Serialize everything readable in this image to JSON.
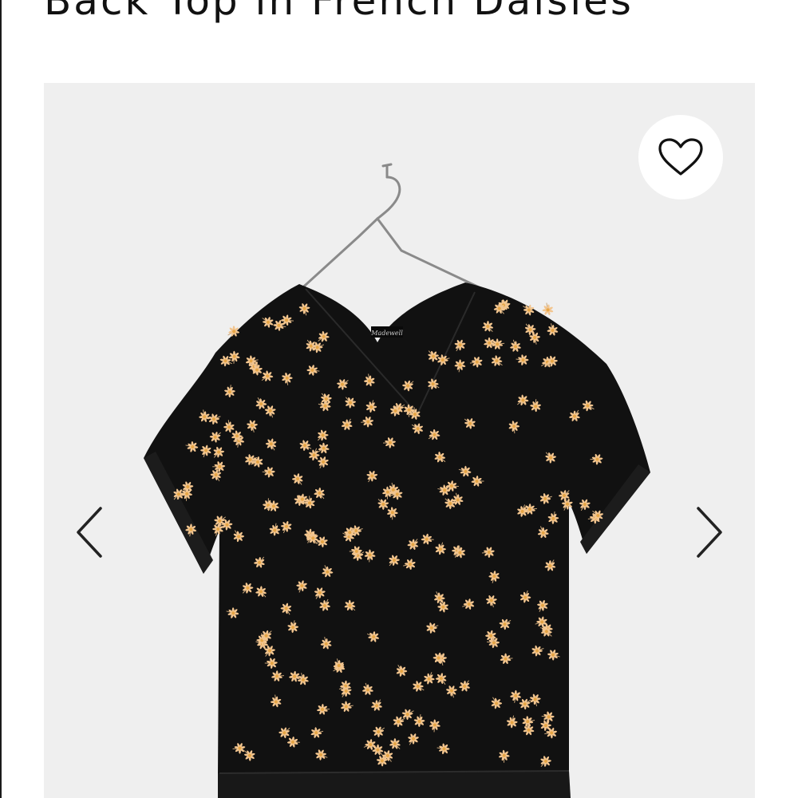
{
  "product": {
    "title": "Back Top in French Daisies",
    "label_text": "Madewell"
  },
  "gallery": {
    "favorite_icon": "heart-outline-icon",
    "prev_icon": "chevron-left-icon",
    "next_icon": "chevron-right-icon"
  },
  "colors": {
    "background": "#efefef",
    "garment": "#111111",
    "daisy_petal": "#f2c58f",
    "daisy_center": "#e6a545",
    "icon": "#111111"
  }
}
